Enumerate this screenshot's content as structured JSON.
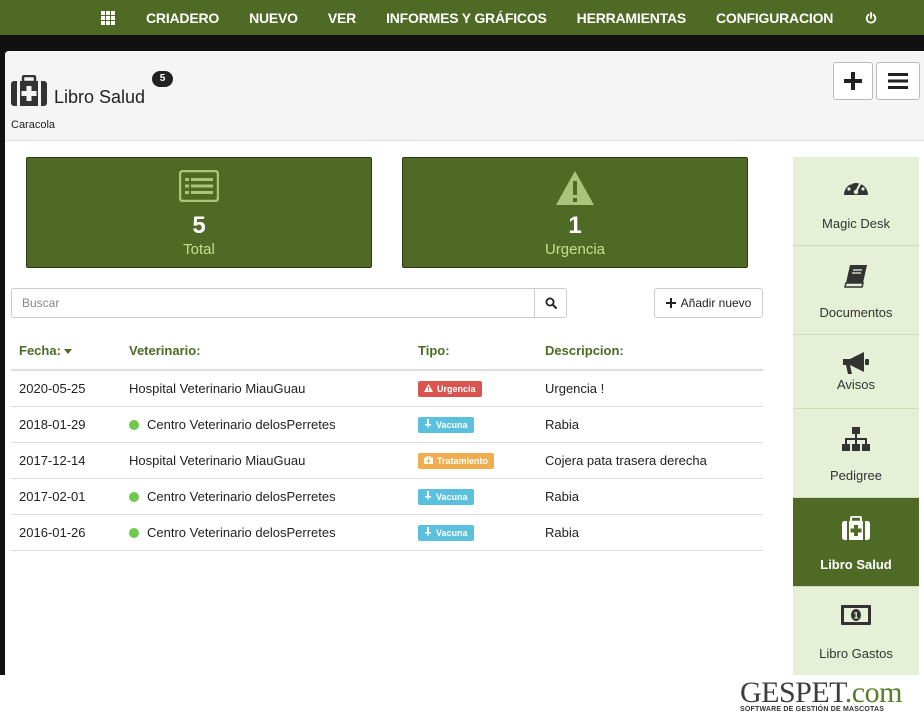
{
  "topnav": {
    "items": [
      "CRIADERO",
      "NUEVO",
      "VER",
      "INFORMES Y GRÁFICOS",
      "HERRAMIENTAS",
      "CONFIGURACION"
    ]
  },
  "header": {
    "title": "Libro Salud",
    "badge": "5",
    "subtitle": "Caracola"
  },
  "stats": [
    {
      "value": "5",
      "label": "Total"
    },
    {
      "value": "1",
      "label": "Urgencia"
    }
  ],
  "search": {
    "placeholder": "Buscar"
  },
  "add_button": "Añadir nuevo",
  "table": {
    "headers": [
      "Fecha:",
      "Veterinario:",
      "Tipo:",
      "Descripcion:"
    ],
    "rows": [
      {
        "fecha": "2020-05-25",
        "vet": "Hospital Veterinario MiauGuau",
        "dot": false,
        "tipo": "Urgencia",
        "tipo_color": "#d9534f",
        "tipo_icon": "warning-icon",
        "desc": "Urgencia !"
      },
      {
        "fecha": "2018-01-29",
        "vet": "Centro Veterinario delosPerretes",
        "dot": true,
        "tipo": "Vacuna",
        "tipo_color": "#5bc0de",
        "tipo_icon": "syringe-icon",
        "desc": "Rabia"
      },
      {
        "fecha": "2017-12-14",
        "vet": "Hospital Veterinario MiauGuau",
        "dot": false,
        "tipo": "Tratamiento",
        "tipo_color": "#f0ad4e",
        "tipo_icon": "medkit-icon",
        "desc": "Cojera pata trasera derecha"
      },
      {
        "fecha": "2017-02-01",
        "vet": "Centro Veterinario delosPerretes",
        "dot": true,
        "tipo": "Vacuna",
        "tipo_color": "#5bc0de",
        "tipo_icon": "syringe-icon",
        "desc": "Rabia"
      },
      {
        "fecha": "2016-01-26",
        "vet": "Centro Veterinario delosPerretes",
        "dot": true,
        "tipo": "Vacuna",
        "tipo_color": "#5bc0de",
        "tipo_icon": "syringe-icon",
        "desc": "Rabia"
      }
    ]
  },
  "sidebar": {
    "items": [
      {
        "label": "Magic Desk",
        "icon": "dashboard-icon",
        "active": false
      },
      {
        "label": "Documentos",
        "icon": "book-icon",
        "active": false
      },
      {
        "label": "Avisos",
        "icon": "megaphone-icon",
        "active": false
      },
      {
        "label": "Pedigree",
        "icon": "sitemap-icon",
        "active": false
      },
      {
        "label": "Libro Salud",
        "icon": "medkit-icon",
        "active": true
      },
      {
        "label": "Libro Gastos",
        "icon": "money-icon",
        "active": false
      }
    ]
  },
  "logo": {
    "main": "GESPET",
    "suffix": ".com",
    "tagline": "SOFTWARE DE GESTIÓN DE MASCOTAS"
  },
  "colors": {
    "brand_green": "#4e6a25",
    "urgent": "#d9534f",
    "vaccine": "#5bc0de",
    "treatment": "#f0ad4e"
  }
}
